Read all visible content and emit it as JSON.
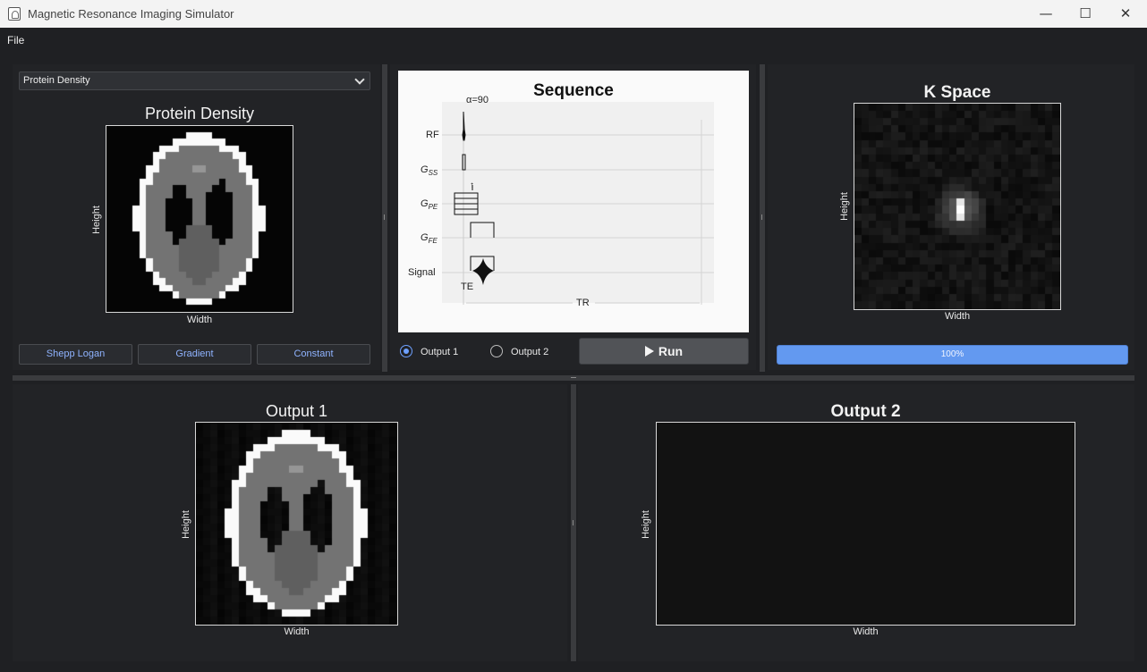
{
  "window": {
    "title": "Magnetic Resonance Imaging Simulator",
    "minimize": "—",
    "maximize": "☐",
    "close": "✕"
  },
  "menu": {
    "file": "File"
  },
  "input_panel": {
    "combo_value": "Protein Density",
    "plot_title": "Protein Density",
    "xlabel": "Width",
    "ylabel": "Height",
    "buttons": [
      "Shepp Logan",
      "Gradient",
      "Constant"
    ]
  },
  "sequence": {
    "title": "Sequence",
    "flip_angle": "α=90",
    "rows": [
      "RF",
      "G",
      "G",
      "G",
      "Signal"
    ],
    "row_subs": [
      "",
      "SS",
      "PE",
      "FE",
      ""
    ],
    "te": "TE",
    "tr": "TR",
    "up_arrow": "↑"
  },
  "outputs": {
    "output1_label": "Output 1",
    "output2_label": "Output 2",
    "selected": "Output 1"
  },
  "run": {
    "label": "Run"
  },
  "kspace": {
    "title": "K Space",
    "xlabel": "Width",
    "ylabel": "Height"
  },
  "progress": {
    "value": 1.0,
    "text": "100%"
  },
  "output1": {
    "title": "Output 1",
    "xlabel": "Width",
    "ylabel": "Height"
  },
  "output2": {
    "title": "Output 2",
    "xlabel": "Width",
    "ylabel": "Height"
  }
}
